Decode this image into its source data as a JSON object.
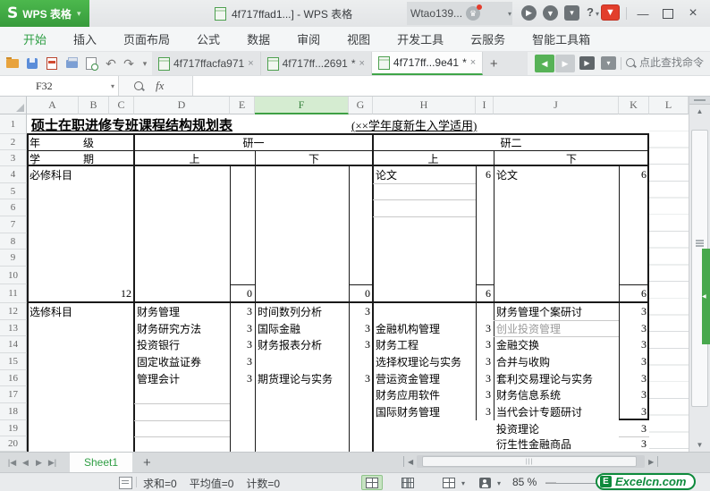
{
  "titlebar": {
    "logo_letter": "S",
    "app_name": "WPS 表格",
    "doc_title": "4f717ffad1...] - WPS 表格",
    "account_name": "Wtao139...",
    "help_label": "?"
  },
  "ribbon": {
    "tabs": [
      "开始",
      "插入",
      "页面布局",
      "公式",
      "数据",
      "审阅",
      "视图",
      "开发工具",
      "云服务",
      "智能工具箱"
    ],
    "active_tab": "开始"
  },
  "toolbar": {
    "doc_tabs": [
      {
        "label": "4f717ffacfa971",
        "dirty": "",
        "close": "×"
      },
      {
        "label": "4f717ff...2691",
        "dirty": "*",
        "close": "×"
      },
      {
        "label": "4f717ff...9e41",
        "dirty": "*",
        "close": "×"
      }
    ],
    "active_doc_tab": "4f717ff...9e41",
    "new_tab_label": "+",
    "search_hint": "点此查找命令"
  },
  "formula_bar": {
    "name_box_value": "F32",
    "fx_label": "fx",
    "formula_value": ""
  },
  "grid": {
    "columns": [
      "A",
      "B",
      "C",
      "D",
      "E",
      "F",
      "G",
      "H",
      "I",
      "J",
      "K",
      "L"
    ],
    "rows": [
      "1",
      "2",
      "3",
      "4",
      "5",
      "6",
      "7",
      "8",
      "9",
      "10",
      "11",
      "12",
      "13",
      "14",
      "15",
      "16",
      "17",
      "18",
      "19",
      "20"
    ],
    "selected_column": "F"
  },
  "table": {
    "title": "硕士在职进修专班课程结构规划表",
    "subtitle": "(××学年度新生入学适用)",
    "header": {
      "year_char1": "年",
      "year_char2": "级",
      "sem_char1": "学",
      "sem_char2": "期",
      "grade1": "研一",
      "grade2": "研二",
      "g1_first": "上",
      "g1_second": "下",
      "g2_first": "上",
      "g2_second": "下"
    },
    "required": {
      "label": "必修科目",
      "thesis1_name": "论文",
      "thesis1_credit": "6",
      "thesis2_name": "论文",
      "thesis2_credit": "6",
      "total_abc": "12",
      "total_e": "0",
      "total_g": "0",
      "total_i": "6",
      "total_k": "6"
    },
    "electives": {
      "label": "选修科目",
      "d": [
        "财务管理",
        "财务研究方法",
        "投资银行",
        "固定收益证券",
        "管理会计"
      ],
      "e": [
        "3",
        "3",
        "3",
        "3",
        "3"
      ],
      "f": [
        "时间数列分析",
        "国际金融",
        "财务报表分析",
        "",
        "期货理论与实务"
      ],
      "g": [
        "3",
        "3",
        "3",
        "",
        "3"
      ],
      "h": [
        "金融机构管理",
        "财务工程",
        "选择权理论与实务",
        "营运资金管理",
        "财务应用软件",
        "国际财务管理"
      ],
      "i": [
        "3",
        "3",
        "3",
        "3",
        "3",
        "3"
      ],
      "j": [
        "财务管理个案研讨",
        "创业投资管理",
        "金融交换",
        "合并与收购",
        "套利交易理论与实务",
        "财务信息系统",
        "当代会计专题研讨",
        "投资理论",
        "衍生性金融商品"
      ],
      "k": [
        "3",
        "3",
        "3",
        "3",
        "3",
        "3",
        "3",
        "3",
        "3"
      ]
    }
  },
  "sheet_bar": {
    "sheet_name": "Sheet1",
    "add_sheet_label": "+"
  },
  "status_bar": {
    "sum": "求和=0",
    "average": "平均值=0",
    "count": "计数=0",
    "zoom_level": "85 %"
  },
  "watermark": {
    "logo_letter": "E",
    "text": "Excelcn.com"
  },
  "icons": {
    "caret_down": "▾",
    "undo": "↶",
    "redo": "↷",
    "back": "◀",
    "forward": "▶",
    "play": "▶",
    "up": "▲",
    "down": "▼",
    "left": "◀",
    "right": "▶",
    "first": "|◀",
    "last": "▶|",
    "minimize": "—",
    "close": "×",
    "crown": "♛",
    "grip": "|||",
    "marker": "◀"
  }
}
